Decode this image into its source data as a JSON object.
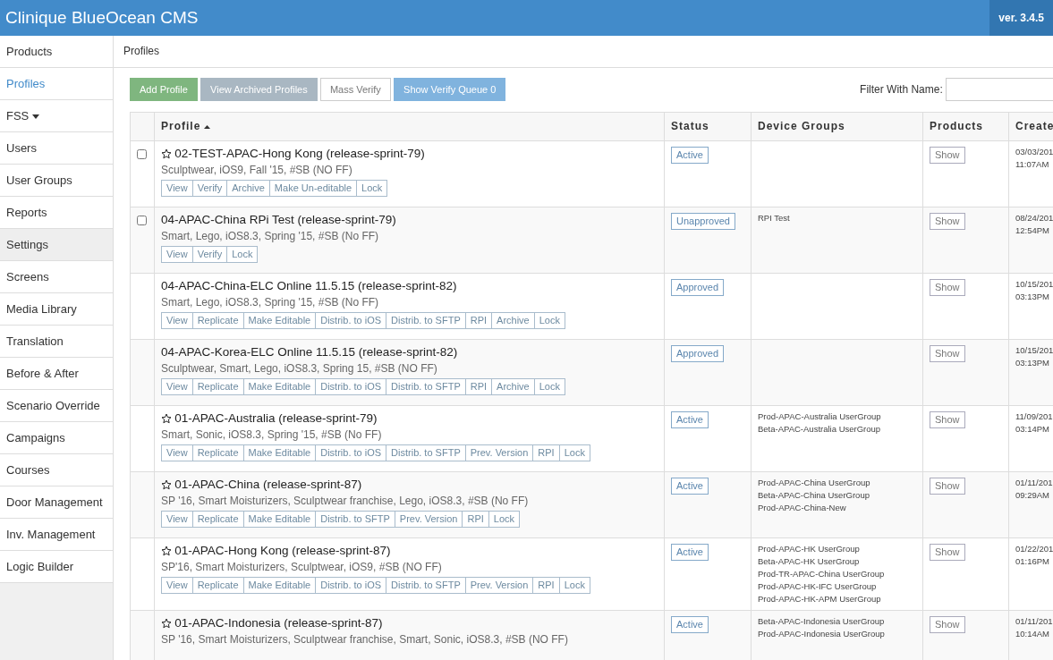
{
  "app": {
    "title": "Clinique BlueOcean CMS",
    "version": "ver. 3.4.5"
  },
  "sidebar": {
    "items": [
      {
        "label": "Products",
        "selected": false,
        "dropdown": false
      },
      {
        "label": "Profiles",
        "selected": true,
        "dropdown": false
      },
      {
        "label": "FSS",
        "selected": false,
        "dropdown": true
      },
      {
        "label": "Users",
        "selected": false,
        "dropdown": false
      },
      {
        "label": "User Groups",
        "selected": false,
        "dropdown": false
      },
      {
        "label": "Reports",
        "selected": false,
        "dropdown": false
      },
      {
        "label": "Settings",
        "selected": false,
        "dropdown": false,
        "hovered": true
      },
      {
        "label": "Screens",
        "selected": false,
        "dropdown": false
      },
      {
        "label": "Media Library",
        "selected": false,
        "dropdown": false
      },
      {
        "label": "Translation",
        "selected": false,
        "dropdown": false
      },
      {
        "label": "Before & After",
        "selected": false,
        "dropdown": false
      },
      {
        "label": "Scenario Override",
        "selected": false,
        "dropdown": false
      },
      {
        "label": "Campaigns",
        "selected": false,
        "dropdown": false
      },
      {
        "label": "Courses",
        "selected": false,
        "dropdown": false
      },
      {
        "label": "Door Management",
        "selected": false,
        "dropdown": false
      },
      {
        "label": "Inv. Management",
        "selected": false,
        "dropdown": false
      },
      {
        "label": "Logic Builder",
        "selected": false,
        "dropdown": false
      }
    ]
  },
  "breadcrumb": "Profiles",
  "toolbar": {
    "buttons": [
      {
        "label": "Add Profile",
        "kind": "success"
      },
      {
        "label": "View Archived Profiles",
        "kind": "muted"
      },
      {
        "label": "Mass Verify",
        "kind": "plain"
      },
      {
        "label": "Show Verify Queue 0",
        "kind": "info"
      }
    ],
    "filter_label": "Filter With Name:"
  },
  "table": {
    "columns": [
      {
        "label": "Profile",
        "sorted": true
      },
      {
        "label": "Status",
        "sorted": false
      },
      {
        "label": "Device Groups",
        "sorted": false
      },
      {
        "label": "Products",
        "sorted": false
      },
      {
        "label": "Create"
      }
    ],
    "rows": [
      {
        "checkbox": true,
        "checked": false,
        "starred": true,
        "name": "02-TEST-APAC-Hong Kong (release-sprint-79)",
        "tags": "Sculptwear, iOS9, Fall '15, #SB (NO FF)",
        "actions": [
          "View",
          "Verify",
          "Archive",
          "Make Un-editable",
          "Lock"
        ],
        "status": "Active",
        "device_groups": [],
        "products": "Show",
        "date": "03/03/201",
        "time": "11:07AM"
      },
      {
        "checkbox": true,
        "checked": false,
        "starred": false,
        "name": "04-APAC-China RPi Test (release-sprint-79)",
        "tags": "Smart, Lego, iOS8.3, Spring '15, #SB (No FF)",
        "actions": [
          "View",
          "Verify",
          "Lock"
        ],
        "status": "Unapproved",
        "device_groups": [
          "RPI Test"
        ],
        "products": "Show",
        "date": "08/24/201",
        "time": "12:54PM"
      },
      {
        "checkbox": false,
        "starred": false,
        "name": "04-APAC-China-ELC Online 11.5.15 (release-sprint-82)",
        "tags": "Smart, Lego, iOS8.3, Spring '15, #SB (No FF)",
        "actions": [
          "View",
          "Replicate",
          "Make Editable",
          "Distrib. to iOS",
          "Distrib. to SFTP",
          "RPI",
          "Archive",
          "Lock"
        ],
        "status": "Approved",
        "device_groups": [],
        "products": "Show",
        "date": "10/15/201",
        "time": "03:13PM"
      },
      {
        "checkbox": false,
        "starred": false,
        "name": "04-APAC-Korea-ELC Online 11.5.15 (release-sprint-82)",
        "tags": "Sculptwear, Smart, Lego, iOS8.3, Spring 15, #SB (NO FF)",
        "actions": [
          "View",
          "Replicate",
          "Make Editable",
          "Distrib. to iOS",
          "Distrib. to SFTP",
          "RPI",
          "Archive",
          "Lock"
        ],
        "status": "Approved",
        "device_groups": [],
        "products": "Show",
        "date": "10/15/201",
        "time": "03:13PM"
      },
      {
        "checkbox": false,
        "starred": true,
        "name": "01-APAC-Australia (release-sprint-79)",
        "tags": "Smart, Sonic, iOS8.3, Spring '15, #SB (No FF)",
        "actions": [
          "View",
          "Replicate",
          "Make Editable",
          "Distrib. to iOS",
          "Distrib. to SFTP",
          "Prev. Version",
          "RPI",
          "Lock"
        ],
        "status": "Active",
        "device_groups": [
          "Prod-APAC-Australia UserGroup",
          "Beta-APAC-Australia UserGroup"
        ],
        "products": "Show",
        "date": "11/09/201",
        "time": "03:14PM"
      },
      {
        "checkbox": false,
        "starred": true,
        "name": "01-APAC-China (release-sprint-87)",
        "tags": "SP '16, Smart Moisturizers, Sculptwear franchise, Lego, iOS8.3, #SB (No FF)",
        "actions": [
          "View",
          "Replicate",
          "Make Editable",
          "Distrib. to SFTP",
          "Prev. Version",
          "RPI",
          "Lock"
        ],
        "status": "Active",
        "device_groups": [
          "Prod-APAC-China UserGroup",
          "Beta-APAC-China UserGroup",
          "Prod-APAC-China-New"
        ],
        "products": "Show",
        "date": "01/11/201",
        "time": "09:29AM"
      },
      {
        "checkbox": false,
        "starred": true,
        "name": "01-APAC-Hong Kong (release-sprint-87)",
        "tags": "SP'16, Smart Moisturizers, Sculptwear, iOS9, #SB (NO FF)",
        "actions": [
          "View",
          "Replicate",
          "Make Editable",
          "Distrib. to iOS",
          "Distrib. to SFTP",
          "Prev. Version",
          "RPI",
          "Lock"
        ],
        "status": "Active",
        "device_groups": [
          "Prod-APAC-HK UserGroup",
          "Beta-APAC-HK UserGroup",
          "Prod-TR-APAC-China UserGroup",
          "Prod-APAC-HK-IFC UserGroup",
          "Prod-APAC-HK-APM UserGroup"
        ],
        "products": "Show",
        "date": "01/22/201",
        "time": "01:16PM"
      },
      {
        "checkbox": false,
        "starred": true,
        "name": "01-APAC-Indonesia (release-sprint-87)",
        "tags": "SP '16, Smart Moisturizers, Sculptwear franchise, Smart, Sonic, iOS8.3, #SB (NO FF)",
        "actions": [],
        "status": "Active",
        "device_groups": [
          "Beta-APAC-Indonesia UserGroup",
          "Prod-APAC-Indonesia UserGroup"
        ],
        "products": "Show",
        "date": "01/11/201",
        "time": "10:14AM"
      }
    ]
  }
}
